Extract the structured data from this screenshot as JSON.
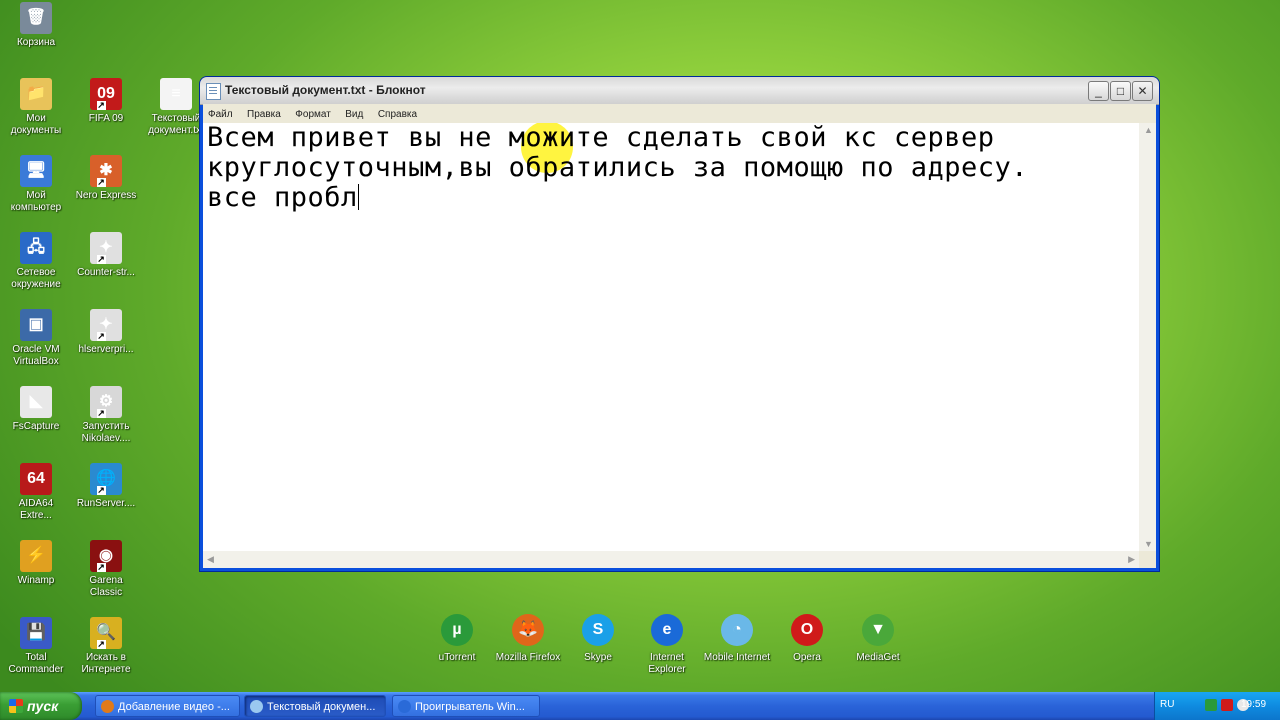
{
  "desktop": {
    "icons": [
      {
        "label": "Корзина",
        "color": "#7a8a9a",
        "glyph": "🗑"
      },
      {
        "label": "Мои документы",
        "color": "#e8c35a",
        "glyph": "📁"
      },
      {
        "label": "FIFA 09",
        "color": "#c21a1a",
        "glyph": "09"
      },
      {
        "label": "Текстовый документ.txt",
        "color": "#f4f4f4",
        "glyph": "≡"
      },
      {
        "label": "Мой компьютер",
        "color": "#3a7ad8",
        "glyph": "🖥"
      },
      {
        "label": "Nero Express",
        "color": "#d8602a",
        "glyph": "✱"
      },
      {
        "label": "Сетевое окружение",
        "color": "#2a6ac8",
        "glyph": "🖧"
      },
      {
        "label": "Counter-str...",
        "color": "#e0e0e0",
        "glyph": "✦"
      },
      {
        "label": "Oracle VM VirtualBox",
        "color": "#3c6aa8",
        "glyph": "▣"
      },
      {
        "label": "hlserverpri...",
        "color": "#e0e0e0",
        "glyph": "✦"
      },
      {
        "label": "FsCapture",
        "color": "#e8e8e8",
        "glyph": "◣"
      },
      {
        "label": "Запустить Nikolaev....",
        "color": "#d8d8d8",
        "glyph": "⚙"
      },
      {
        "label": "AIDA64 Extre...",
        "color": "#b81a1a",
        "glyph": "64"
      },
      {
        "label": "RunServer....",
        "color": "#2a8ad0",
        "glyph": "🌐"
      },
      {
        "label": "Winamp",
        "color": "#e0a020",
        "glyph": "⚡"
      },
      {
        "label": "Garena Classic",
        "color": "#8a1010",
        "glyph": "◉"
      },
      {
        "label": "Total Commander",
        "color": "#3a5ac8",
        "glyph": "💾"
      },
      {
        "label": "Искать в Интернете",
        "color": "#d8b020",
        "glyph": "🔍"
      }
    ],
    "dock": [
      {
        "label": "uTorrent",
        "color": "#2a9a3a",
        "glyph": "µ"
      },
      {
        "label": "Mozilla Firefox",
        "color": "#e0661a",
        "glyph": "🦊"
      },
      {
        "label": "Skype",
        "color": "#1aa0e8",
        "glyph": "S"
      },
      {
        "label": "Internet Explorer",
        "color": "#1a6ad8",
        "glyph": "e"
      },
      {
        "label": "Mobile Internet",
        "color": "#6ab8e8",
        "glyph": "◔"
      },
      {
        "label": "Opera",
        "color": "#d01a1a",
        "glyph": "O"
      },
      {
        "label": "MediaGet",
        "color": "#4aa83a",
        "glyph": "▼"
      }
    ]
  },
  "notepad": {
    "title": "Текстовый документ.txt - Блокнот",
    "menu": [
      "Файл",
      "Правка",
      "Формат",
      "Вид",
      "Справка"
    ],
    "lines": [
      "Всем привет вы не можите сделать свой кс сервер",
      "круглосуточным,вы обратились за помощю по адресу.",
      "все пробл"
    ],
    "buttons": {
      "minimize": "_",
      "maximize": "□",
      "close": "✕"
    }
  },
  "taskbar": {
    "start_label": "пуск",
    "tasks": [
      {
        "label": "Добавление видео -...",
        "color": "#e07a1a"
      },
      {
        "label": "Текстовый докумен...",
        "color": "#9ac8f0"
      },
      {
        "label": "Проигрыватель Win...",
        "color": "#2a6ad8"
      }
    ],
    "language": "RU",
    "clock": "19:59"
  }
}
